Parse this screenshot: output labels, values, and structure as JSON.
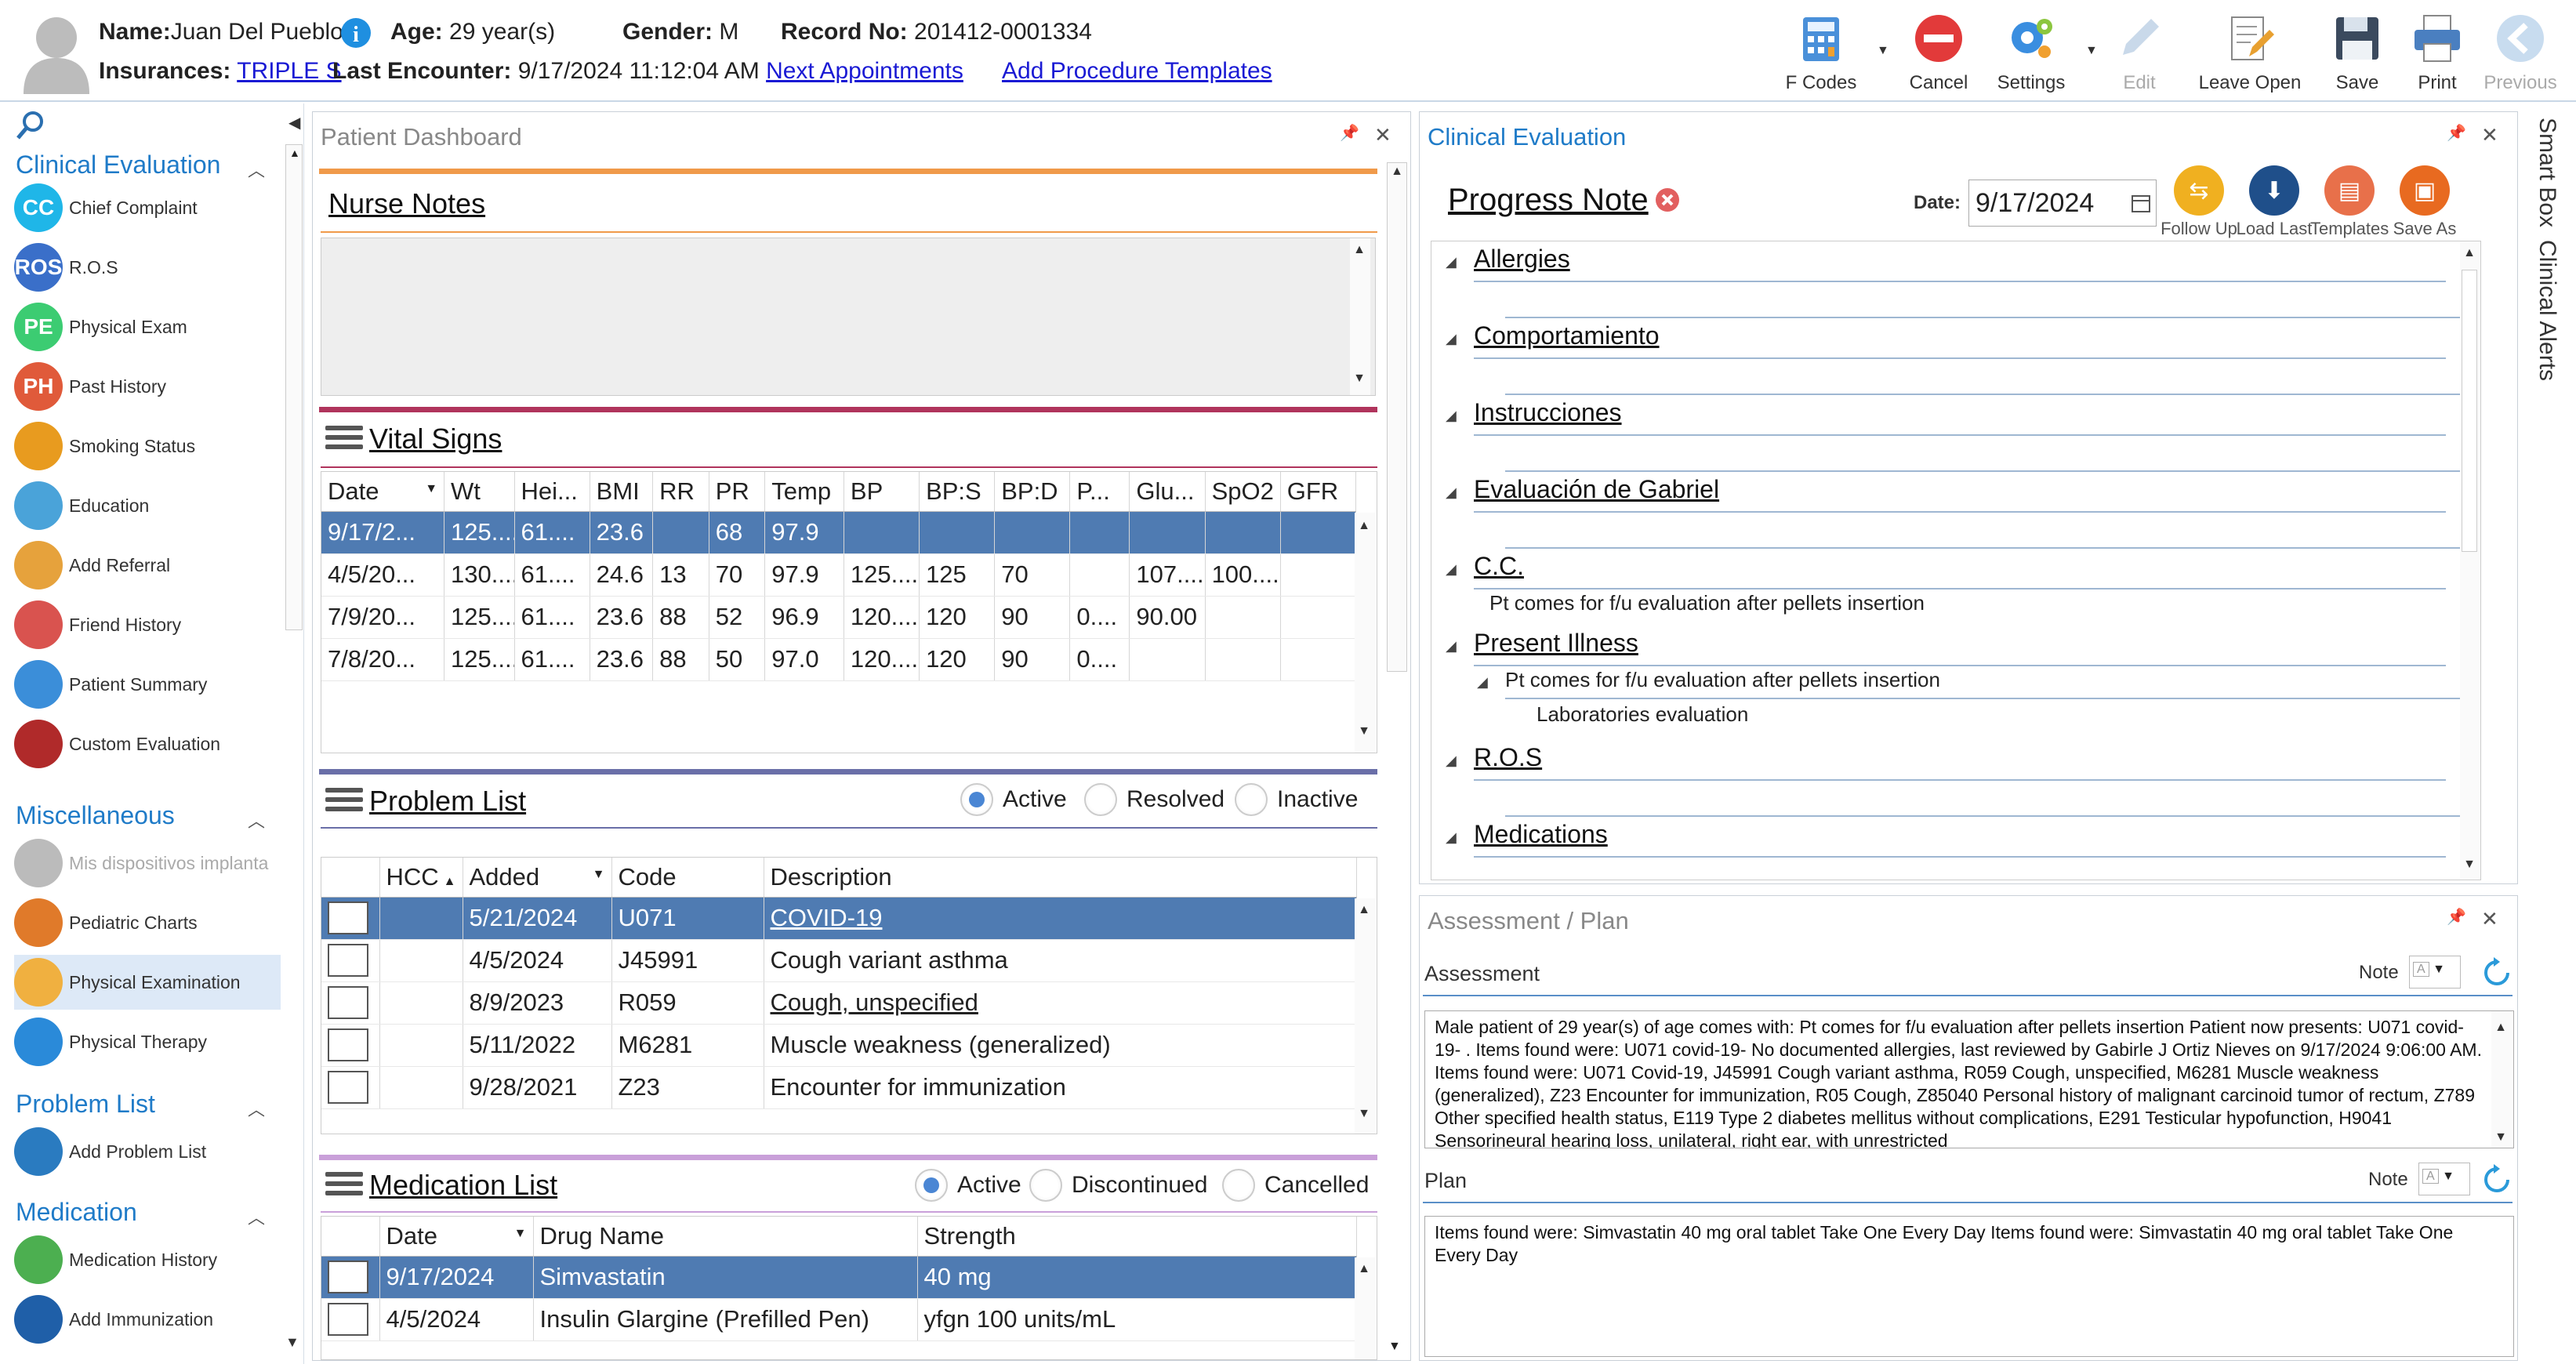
{
  "header": {
    "name_label": "Name:",
    "name_value": "Juan Del Pueblo",
    "age_label": "Age:",
    "age_value": "29 year(s)",
    "gender_label": "Gender:",
    "gender_value": "M",
    "record_label": "Record No:",
    "record_value": "201412-0001334",
    "insurances_label": "Insurances:",
    "insurance_value": "TRIPLE S",
    "last_encounter_label": "Last Encounter:",
    "last_encounter_value": "9/17/2024 11:12:04 AM",
    "next_appointments": "Next Appointments",
    "add_procedure_templates": "Add Procedure Templates"
  },
  "toolbar": {
    "fcodes": "F Codes",
    "cancel": "Cancel",
    "settings": "Settings",
    "edit": "Edit",
    "leave_open": "Leave Open",
    "save": "Save",
    "print": "Print",
    "previous": "Previous"
  },
  "sidebar": {
    "sections": [
      {
        "title": "Clinical Evaluation",
        "items": [
          {
            "label": "Chief Complaint",
            "abbr": "CC",
            "color": "#1fb6e8"
          },
          {
            "label": "R.O.S",
            "abbr": "ROS",
            "color": "#3a6fc9"
          },
          {
            "label": "Physical Exam",
            "abbr": "PE",
            "color": "#3ccc72"
          },
          {
            "label": "Past History",
            "abbr": "PH",
            "color": "#e05a3a"
          },
          {
            "label": "Smoking Status",
            "abbr": "",
            "color": "#e89b1f"
          },
          {
            "label": "Education",
            "abbr": "",
            "color": "#4aa3d9"
          },
          {
            "label": "Add Referral",
            "abbr": "",
            "color": "#e6a23c"
          },
          {
            "label": "Friend History",
            "abbr": "",
            "color": "#d9534f"
          },
          {
            "label": "Patient Summary",
            "abbr": "",
            "color": "#3b8ed9"
          },
          {
            "label": "Custom Evaluation",
            "abbr": "",
            "color": "#b02a2a"
          }
        ]
      },
      {
        "title": "Miscellaneous",
        "items": [
          {
            "label": "Mis dispositivos implanta",
            "abbr": "",
            "color": "#bbbbbb"
          },
          {
            "label": "Pediatric Charts",
            "abbr": "",
            "color": "#e07a2a"
          },
          {
            "label": "Physical Examination",
            "abbr": "",
            "color": "#f0b040"
          },
          {
            "label": "Physical Therapy",
            "abbr": "",
            "color": "#2a8ad9"
          }
        ]
      },
      {
        "title": "Problem List",
        "items": [
          {
            "label": "Add Problem List",
            "abbr": "",
            "color": "#2a7bc0"
          }
        ]
      },
      {
        "title": "Medication",
        "items": [
          {
            "label": "Medication History",
            "abbr": "",
            "color": "#4caf50"
          },
          {
            "label": "Add Immunization",
            "abbr": "",
            "color": "#1f5fa8"
          }
        ]
      }
    ]
  },
  "dashboard": {
    "title": "Patient Dashboard",
    "nurse_notes": "Nurse Notes",
    "vital_signs": "Vital Signs",
    "vital_headers": [
      "Date",
      "Wt",
      "Hei...",
      "BMI",
      "RR",
      "PR",
      "Temp",
      "BP",
      "BP:S",
      "BP:D",
      "P...",
      "Glu...",
      "SpO2",
      "GFR"
    ],
    "vital_rows": [
      [
        "9/17/2...",
        "125....",
        "61....",
        "23.6",
        "",
        "68",
        "97.9",
        "",
        "",
        "",
        "",
        "",
        "",
        ""
      ],
      [
        "4/5/20...",
        "130....",
        "61....",
        "24.6",
        "13",
        "70",
        "97.9",
        "125....",
        "125",
        "70",
        "",
        "107....",
        "100....",
        ""
      ],
      [
        "7/9/20...",
        "125....",
        "61....",
        "23.6",
        "88",
        "52",
        "96.9",
        "120....",
        "120",
        "90",
        "0....",
        "90.00",
        "",
        ""
      ],
      [
        "7/8/20...",
        "125....",
        "61....",
        "23.6",
        "88",
        "50",
        "97.0",
        "120....",
        "120",
        "90",
        "0....",
        "",
        "",
        ""
      ]
    ],
    "problem_list": "Problem List",
    "problem_filters": [
      "Active",
      "Resolved",
      "Inactive"
    ],
    "problem_headers": [
      "",
      "HCC",
      "Added",
      "Code",
      "Description"
    ],
    "problem_rows": [
      [
        "",
        "",
        "5/21/2024",
        "U071",
        "COVID-19"
      ],
      [
        "",
        "",
        "4/5/2024",
        "J45991",
        "Cough variant asthma"
      ],
      [
        "",
        "",
        "8/9/2023",
        "R059",
        "Cough, unspecified"
      ],
      [
        "",
        "",
        "5/11/2022",
        "M6281",
        "Muscle weakness (generalized)"
      ],
      [
        "",
        "",
        "9/28/2021",
        "Z23",
        "Encounter for immunization"
      ]
    ],
    "medication_list": "Medication List",
    "medication_filters": [
      "Active",
      "Discontinued",
      "Cancelled"
    ],
    "medication_headers": [
      "",
      "Date",
      "Drug Name",
      "Strength"
    ],
    "medication_rows": [
      [
        "",
        "9/17/2024",
        "Simvastatin",
        "40 mg"
      ],
      [
        "",
        "4/5/2024",
        "Insulin Glargine (Prefilled Pen)",
        "yfgn 100 units/mL"
      ]
    ]
  },
  "clinical": {
    "title": "Clinical Evaluation",
    "progress_note": "Progress Note",
    "date_label": "Date:",
    "date_value": "9/17/2024",
    "buttons": [
      "Follow Up",
      "Load Last",
      "Templates",
      "Save As"
    ],
    "sections": [
      {
        "name": "Allergies",
        "lines": []
      },
      {
        "name": "Comportamiento",
        "lines": []
      },
      {
        "name": "Instrucciones",
        "lines": []
      },
      {
        "name": "Evaluación de Gabriel",
        "lines": []
      },
      {
        "name": "C.C.",
        "lines": [
          "Pt comes for f/u evaluation after pellets insertion"
        ]
      },
      {
        "name": "Present Illness",
        "lines": [
          "Pt comes for f/u evaluation after pellets insertion",
          "Laboratories evaluation"
        ]
      },
      {
        "name": "R.O.S",
        "lines": []
      },
      {
        "name": "Medications",
        "lines": []
      }
    ]
  },
  "assessment": {
    "title": "Assessment / Plan",
    "assessment_label": "Assessment",
    "note_label": "Note",
    "assessment_text": "Male patient of 29 year(s) of age comes with:  Pt comes for f/u evaluation after pellets insertion  Patient now presents: U071 covid-19- . Items found were:  U071 covid-19-    No documented allergies, last reviewed by Gabirle J Ortiz Nieves on 9/17/2024 9:06:00 AM.    Items found were:  U071 Covid-19, J45991 Cough variant asthma, R059 Cough, unspecified, M6281 Muscle weakness (generalized), Z23 Encounter for immunization, R05 Cough, Z85040 Personal history of malignant carcinoid tumor of rectum, Z789 Other specified health status, E119 Type 2 diabetes mellitus without complications, E291 Testicular hypofunction, H9041 Sensorineural hearing loss, unilateral, right ear, with unrestricted",
    "plan_label": "Plan",
    "plan_text": "  Items found were:  Simvastatin 40 mg oral tablet Take One Every Day   Items found were:  Simvastatin 40 mg oral tablet Take One Every Day"
  },
  "side_tabs": [
    "Smart Box",
    "Clinical Alerts"
  ]
}
